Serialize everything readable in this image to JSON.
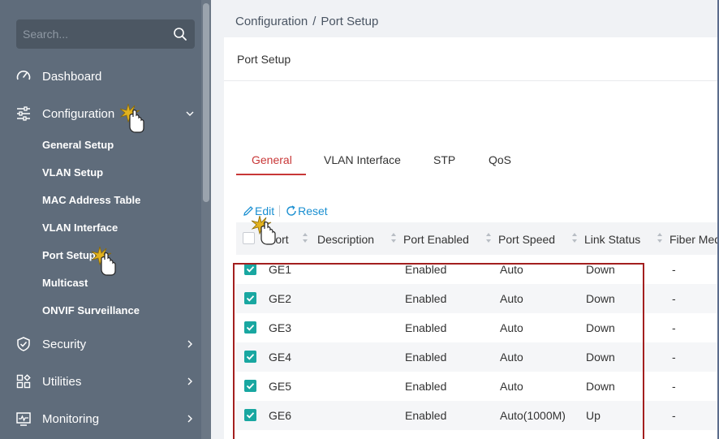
{
  "sidebar": {
    "search_placeholder": "Search...",
    "items": [
      {
        "label": "Dashboard"
      },
      {
        "label": "Configuration"
      },
      {
        "label": "Security"
      },
      {
        "label": "Utilities"
      },
      {
        "label": "Monitoring"
      }
    ],
    "config_sub": [
      {
        "label": "General Setup"
      },
      {
        "label": "VLAN Setup"
      },
      {
        "label": "MAC Address Table"
      },
      {
        "label": "VLAN Interface"
      },
      {
        "label": "Port Setup"
      },
      {
        "label": "Multicast"
      },
      {
        "label": "ONVIF Surveillance"
      }
    ]
  },
  "breadcrumb": {
    "parent": "Configuration",
    "separator": "/",
    "current": "Port Setup"
  },
  "card": {
    "title": "Port Setup"
  },
  "tabs": [
    {
      "label": "General",
      "active": true
    },
    {
      "label": "VLAN Interface"
    },
    {
      "label": "STP"
    },
    {
      "label": "QoS"
    }
  ],
  "toolbar": {
    "edit_label": "Edit",
    "reset_label": "Reset"
  },
  "table": {
    "columns": [
      "Port",
      "Description",
      "Port Enabled",
      "Port Speed",
      "Link Status",
      "Fiber Media"
    ],
    "rows": [
      {
        "port": "GE1",
        "description": "",
        "enabled": "Enabled",
        "speed": "Auto",
        "link": "Down",
        "fiber": "-"
      },
      {
        "port": "GE2",
        "description": "",
        "enabled": "Enabled",
        "speed": "Auto",
        "link": "Down",
        "fiber": "-"
      },
      {
        "port": "GE3",
        "description": "",
        "enabled": "Enabled",
        "speed": "Auto",
        "link": "Down",
        "fiber": "-"
      },
      {
        "port": "GE4",
        "description": "",
        "enabled": "Enabled",
        "speed": "Auto",
        "link": "Down",
        "fiber": "-"
      },
      {
        "port": "GE5",
        "description": "",
        "enabled": "Enabled",
        "speed": "Auto",
        "link": "Down",
        "fiber": "-"
      },
      {
        "port": "GE6",
        "description": "",
        "enabled": "Enabled",
        "speed": "Auto(1000M)",
        "link": "Up",
        "fiber": "-"
      }
    ]
  },
  "colors": {
    "sidebar_bg": "#5f6c7b",
    "accent_red": "#c83737",
    "link_blue": "#1a8fd1",
    "check_teal": "#19a7a1",
    "highlight_border": "#a31f1f"
  }
}
